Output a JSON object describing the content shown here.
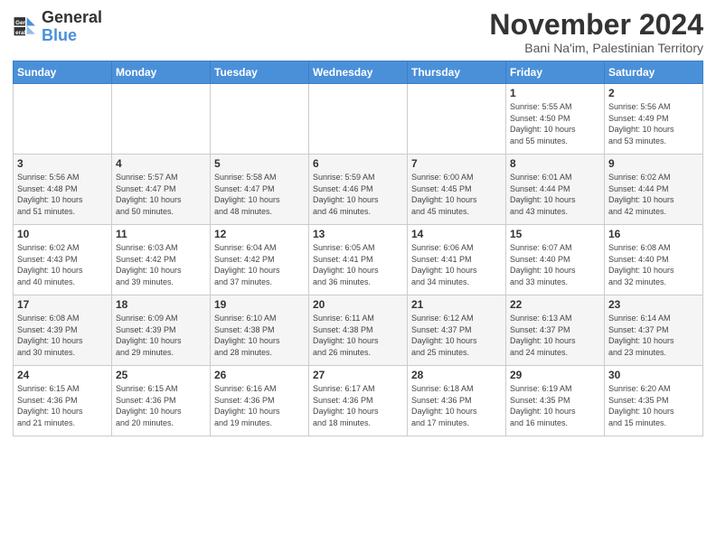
{
  "logo": {
    "line1": "General",
    "line2": "Blue"
  },
  "title": "November 2024",
  "subtitle": "Bani Na'im, Palestinian Territory",
  "headers": [
    "Sunday",
    "Monday",
    "Tuesday",
    "Wednesday",
    "Thursday",
    "Friday",
    "Saturday"
  ],
  "weeks": [
    [
      {
        "day": "",
        "info": ""
      },
      {
        "day": "",
        "info": ""
      },
      {
        "day": "",
        "info": ""
      },
      {
        "day": "",
        "info": ""
      },
      {
        "day": "",
        "info": ""
      },
      {
        "day": "1",
        "info": "Sunrise: 5:55 AM\nSunset: 4:50 PM\nDaylight: 10 hours\nand 55 minutes."
      },
      {
        "day": "2",
        "info": "Sunrise: 5:56 AM\nSunset: 4:49 PM\nDaylight: 10 hours\nand 53 minutes."
      }
    ],
    [
      {
        "day": "3",
        "info": "Sunrise: 5:56 AM\nSunset: 4:48 PM\nDaylight: 10 hours\nand 51 minutes."
      },
      {
        "day": "4",
        "info": "Sunrise: 5:57 AM\nSunset: 4:47 PM\nDaylight: 10 hours\nand 50 minutes."
      },
      {
        "day": "5",
        "info": "Sunrise: 5:58 AM\nSunset: 4:47 PM\nDaylight: 10 hours\nand 48 minutes."
      },
      {
        "day": "6",
        "info": "Sunrise: 5:59 AM\nSunset: 4:46 PM\nDaylight: 10 hours\nand 46 minutes."
      },
      {
        "day": "7",
        "info": "Sunrise: 6:00 AM\nSunset: 4:45 PM\nDaylight: 10 hours\nand 45 minutes."
      },
      {
        "day": "8",
        "info": "Sunrise: 6:01 AM\nSunset: 4:44 PM\nDaylight: 10 hours\nand 43 minutes."
      },
      {
        "day": "9",
        "info": "Sunrise: 6:02 AM\nSunset: 4:44 PM\nDaylight: 10 hours\nand 42 minutes."
      }
    ],
    [
      {
        "day": "10",
        "info": "Sunrise: 6:02 AM\nSunset: 4:43 PM\nDaylight: 10 hours\nand 40 minutes."
      },
      {
        "day": "11",
        "info": "Sunrise: 6:03 AM\nSunset: 4:42 PM\nDaylight: 10 hours\nand 39 minutes."
      },
      {
        "day": "12",
        "info": "Sunrise: 6:04 AM\nSunset: 4:42 PM\nDaylight: 10 hours\nand 37 minutes."
      },
      {
        "day": "13",
        "info": "Sunrise: 6:05 AM\nSunset: 4:41 PM\nDaylight: 10 hours\nand 36 minutes."
      },
      {
        "day": "14",
        "info": "Sunrise: 6:06 AM\nSunset: 4:41 PM\nDaylight: 10 hours\nand 34 minutes."
      },
      {
        "day": "15",
        "info": "Sunrise: 6:07 AM\nSunset: 4:40 PM\nDaylight: 10 hours\nand 33 minutes."
      },
      {
        "day": "16",
        "info": "Sunrise: 6:08 AM\nSunset: 4:40 PM\nDaylight: 10 hours\nand 32 minutes."
      }
    ],
    [
      {
        "day": "17",
        "info": "Sunrise: 6:08 AM\nSunset: 4:39 PM\nDaylight: 10 hours\nand 30 minutes."
      },
      {
        "day": "18",
        "info": "Sunrise: 6:09 AM\nSunset: 4:39 PM\nDaylight: 10 hours\nand 29 minutes."
      },
      {
        "day": "19",
        "info": "Sunrise: 6:10 AM\nSunset: 4:38 PM\nDaylight: 10 hours\nand 28 minutes."
      },
      {
        "day": "20",
        "info": "Sunrise: 6:11 AM\nSunset: 4:38 PM\nDaylight: 10 hours\nand 26 minutes."
      },
      {
        "day": "21",
        "info": "Sunrise: 6:12 AM\nSunset: 4:37 PM\nDaylight: 10 hours\nand 25 minutes."
      },
      {
        "day": "22",
        "info": "Sunrise: 6:13 AM\nSunset: 4:37 PM\nDaylight: 10 hours\nand 24 minutes."
      },
      {
        "day": "23",
        "info": "Sunrise: 6:14 AM\nSunset: 4:37 PM\nDaylight: 10 hours\nand 23 minutes."
      }
    ],
    [
      {
        "day": "24",
        "info": "Sunrise: 6:15 AM\nSunset: 4:36 PM\nDaylight: 10 hours\nand 21 minutes."
      },
      {
        "day": "25",
        "info": "Sunrise: 6:15 AM\nSunset: 4:36 PM\nDaylight: 10 hours\nand 20 minutes."
      },
      {
        "day": "26",
        "info": "Sunrise: 6:16 AM\nSunset: 4:36 PM\nDaylight: 10 hours\nand 19 minutes."
      },
      {
        "day": "27",
        "info": "Sunrise: 6:17 AM\nSunset: 4:36 PM\nDaylight: 10 hours\nand 18 minutes."
      },
      {
        "day": "28",
        "info": "Sunrise: 6:18 AM\nSunset: 4:36 PM\nDaylight: 10 hours\nand 17 minutes."
      },
      {
        "day": "29",
        "info": "Sunrise: 6:19 AM\nSunset: 4:35 PM\nDaylight: 10 hours\nand 16 minutes."
      },
      {
        "day": "30",
        "info": "Sunrise: 6:20 AM\nSunset: 4:35 PM\nDaylight: 10 hours\nand 15 minutes."
      }
    ]
  ],
  "colors": {
    "header_bg": "#4a90d9",
    "header_text": "#ffffff",
    "row_even": "#f5f5f5",
    "row_odd": "#ffffff",
    "border": "#cccccc"
  }
}
